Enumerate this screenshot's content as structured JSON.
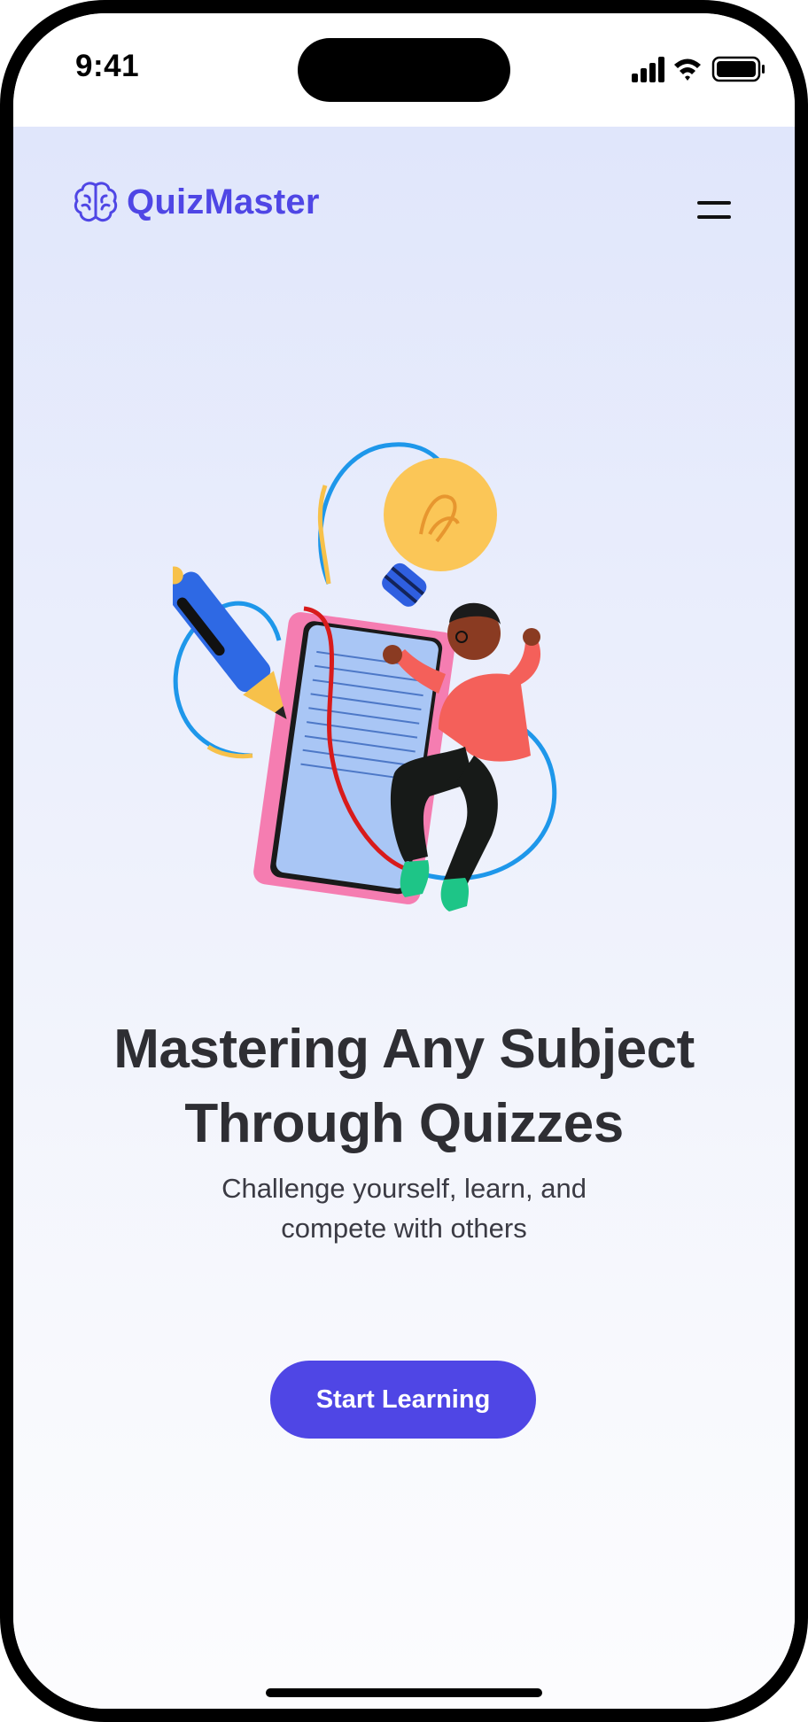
{
  "status_bar": {
    "time": "9:41",
    "icons": [
      "cellular-signal-icon",
      "wifi-icon",
      "battery-icon"
    ]
  },
  "header": {
    "logo_icon": "brain-icon",
    "brand_name": "QuizMaster",
    "brand_color": "#4f46e5",
    "menu_icon": "hamburger-menu-icon"
  },
  "hero": {
    "illustration": "person-with-notebook-pencil-lightbulb-illustration",
    "title_line1": "Mastering Any Subject",
    "title_line2": "Through Quizzes",
    "subtitle_line1": "Challenge yourself, learn, and",
    "subtitle_line2": "compete with others",
    "cta_label": "Start Learning",
    "cta_color": "#4f46e5"
  }
}
